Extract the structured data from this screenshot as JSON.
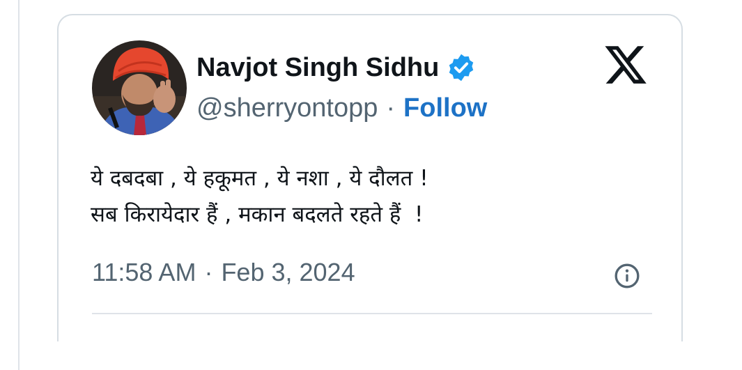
{
  "tweet": {
    "author": {
      "display_name": "Navjot Singh Sidhu",
      "handle": "@sherryontopp",
      "verified": true,
      "avatar_description": "avatar"
    },
    "separator": "·",
    "follow_label": "Follow",
    "text_lines": [
      "ये दबदबा , ये हकूमत , ये नशा , ये दौलत !",
      "सब किरायेदार हैं , मकान बदलते रहते हैं  !"
    ],
    "time": "11:58 AM",
    "date": "Feb 3, 2024",
    "icons": {
      "verified": "verified-badge-icon",
      "brand": "x-logo-icon",
      "info": "info-icon"
    }
  },
  "colors": {
    "follow": "#1d72c6",
    "verified": "#1d9bf0",
    "text": "#0f1419",
    "muted": "#536471",
    "border": "#d6dde3"
  }
}
